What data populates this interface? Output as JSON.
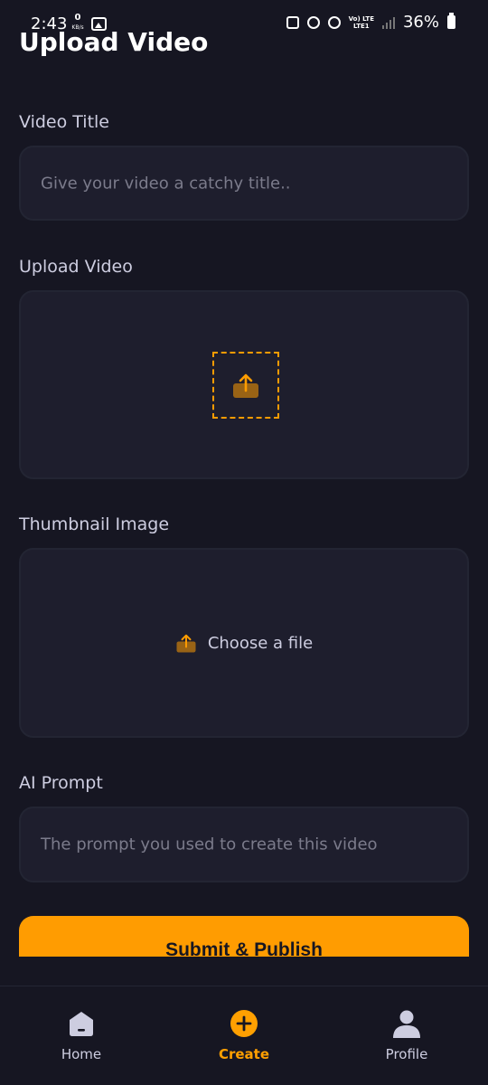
{
  "status_bar": {
    "time": "2:43",
    "net_speed_value": "0",
    "net_speed_unit": "KB/s",
    "network_top": "Vo) LTE",
    "network_bottom": "LTE1",
    "battery_percent": "36%"
  },
  "page": {
    "title": "Upload Video"
  },
  "form": {
    "video_title": {
      "label": "Video Title",
      "placeholder": "Give your video a catchy title.."
    },
    "upload_video": {
      "label": "Upload Video",
      "icon": "upload-icon"
    },
    "thumbnail": {
      "label": "Thumbnail Image",
      "choose_label": "Choose a file",
      "icon": "upload-icon"
    },
    "ai_prompt": {
      "label": "AI Prompt",
      "placeholder": "The prompt you used to create this video"
    },
    "submit_label": "Submit & Publish"
  },
  "tabs": [
    {
      "label": "Home",
      "icon": "home-icon",
      "active": false
    },
    {
      "label": "Create",
      "icon": "plus-icon",
      "active": true
    },
    {
      "label": "Profile",
      "icon": "profile-icon",
      "active": false
    }
  ],
  "colors": {
    "background": "#161622",
    "field": "#1E1E2D",
    "accent": "#FF9C01",
    "label": "#CDCDE0",
    "placeholder": "#7B7B8B"
  }
}
